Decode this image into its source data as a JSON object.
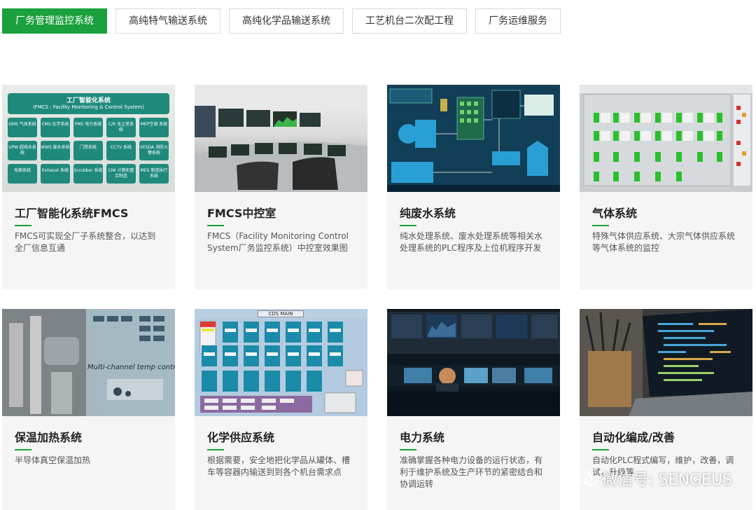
{
  "tabs": [
    {
      "label": "厂务管理监控系统",
      "active": true
    },
    {
      "label": "高纯特气输送系统",
      "active": false
    },
    {
      "label": "高纯化学品输送系统",
      "active": false
    },
    {
      "label": "工艺机台二次配工程",
      "active": false
    },
    {
      "label": "厂务运维服务",
      "active": false
    }
  ],
  "cards": [
    {
      "title": "工厂智能化系统FMCS",
      "desc": "FMCS可实现全厂子系统整合，以达到全厂信息互通"
    },
    {
      "title": "FMCS中控室",
      "desc": "FMCS（Facility Monitoring Control System厂务监控系统）中控室效果图"
    },
    {
      "title": "纯废水系统",
      "desc": "纯水处理系统、废水处理系统等相关水处理系统的PLC程序及上位机程序开发"
    },
    {
      "title": "气体系统",
      "desc": "特殊气体供应系统、大宗气体供应系统等气体系统的监控"
    },
    {
      "title": "保温加热系统",
      "desc": "半导体真空保温加热"
    },
    {
      "title": "化学供应系统",
      "desc": "根据需要，安全地把化学品从罐体、槽车等容器内输送到到各个机台需求点"
    },
    {
      "title": "电力系统",
      "desc": "准确掌握各种电力设备的运行状态，有利于维护系统及生产环节的紧密结合和协调运转"
    },
    {
      "title": "自动化编成/改善",
      "desc": "自动化PLC程式编写，维护，改善，调试，升级等"
    }
  ],
  "fmcs_image": {
    "heading": "工厂智能化系统",
    "subheading": "(FMCS : Facility Monitoring & Control System)",
    "modules": [
      [
        "GMS 气体系统",
        "CMS 化学系统",
        "PMS 电力系统",
        "C/R 无尘室系统",
        "MEP空调 系统"
      ],
      [
        "UPW 超纯水系统",
        "WWS 废水系统",
        "门禁系统",
        "CCTV 系统",
        "VESDA 消防火警系统"
      ],
      [
        "电梯系统",
        "Exhaust 系统",
        "Scrubber 系统",
        "CIM 计算机整合制造",
        "MES 制造执行系统"
      ]
    ]
  },
  "cds_image": {
    "title": "CDS MAIN"
  },
  "heat_image": {
    "title": "Multi-channel temp control"
  },
  "watermark": {
    "text": "微信号: SENGEUS"
  }
}
